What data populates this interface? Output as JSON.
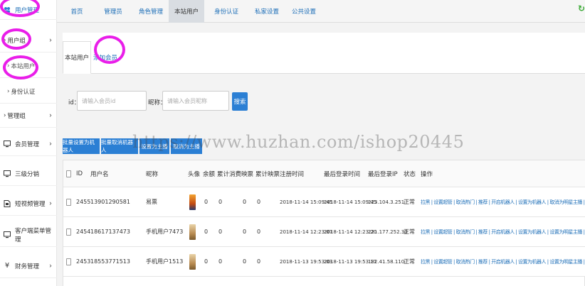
{
  "sidebar": {
    "items": [
      {
        "label": "用户管理",
        "icon": "users-icon"
      },
      {
        "label": "用户组",
        "icon": "group-icon"
      },
      {
        "label": "本站用户",
        "icon": "none"
      },
      {
        "label": "身份认证",
        "icon": "none"
      },
      {
        "label": "管理组",
        "icon": "none"
      },
      {
        "label": "会员管理",
        "icon": "monitor-icon"
      },
      {
        "label": "三级分销",
        "icon": "monitor-icon"
      },
      {
        "label": "短视频管理",
        "icon": "file-icon"
      },
      {
        "label": "客户端菜单管理",
        "icon": "monitor-icon"
      },
      {
        "label": "财务管理",
        "icon": "yen-icon"
      }
    ]
  },
  "topnav": {
    "items": [
      "首页",
      "管理员",
      "角色管理",
      "本站用户",
      "身份认证",
      "私家设置",
      "公共设置"
    ],
    "active": "本站用户"
  },
  "subtabs": {
    "items": [
      "本站用户",
      "添加会员"
    ],
    "active": "本站用户"
  },
  "search": {
    "id_label": "id：",
    "id_placeholder": "请输入会员id",
    "nick_label": "昵称：",
    "nick_placeholder": "请输入会员昵称",
    "button": "搜索"
  },
  "bulk_actions": [
    "批量设置为机器人",
    "批量取消机器人",
    "设置为主播",
    "取消为主播"
  ],
  "table": {
    "columns": [
      "ID",
      "用户名",
      "昵称",
      "头像",
      "余额",
      "累计消费",
      "映票",
      "累计映票",
      "注册时间",
      "最后登录时间",
      "最后登录IP",
      "状态",
      "操作"
    ],
    "rows": [
      {
        "id": "2455",
        "username": "13901290581",
        "nickname": "易票",
        "balance": "0",
        "total_spent": "0",
        "tickets": "0",
        "total_tickets": "0",
        "registered": "2018-11-14 15:09:45",
        "last_login": "2018-11-14 15:09:45",
        "last_ip": "223.104.3.251",
        "status": "正常",
        "actions": "拉黑 | 设置超管 | 取消热门 | 推荐 | 开启机器人 | 设置为机器人 | 取消为明星主播 | 编辑 | 删除"
      },
      {
        "id": "2454",
        "username": "18617137473",
        "nickname": "手机用户7473",
        "balance": "0",
        "total_spent": "0",
        "tickets": "0",
        "total_tickets": "0",
        "registered": "2018-11-14 12:23:07",
        "last_login": "2018-11-14 12:23:20",
        "last_ip": "221.177.252.30",
        "status": "正常",
        "actions": "拉黑 | 设置超管 | 取消热门 | 推荐 | 开启机器人 | 设置为机器人 | 设置为明星主播 | 编辑 | 删除"
      },
      {
        "id": "2453",
        "username": "18553771513",
        "nickname": "手机用户1513",
        "balance": "0",
        "total_spent": "0",
        "tickets": "0",
        "total_tickets": "0",
        "registered": "2018-11-13 19:53:03",
        "last_login": "2018-11-13 19:53:11",
        "last_ip": "182.41.58.110",
        "status": "正常",
        "actions": "拉黑 | 设置超管 | 取消热门 | 推荐 | 开启机器人 | 设置为机器人 | 设置为明星主播 | 编辑 | 删除"
      }
    ]
  },
  "watermark": "https://www.huzhan.com/ishop20445",
  "colors": {
    "link": "#1e6fb8",
    "button": "#2b7fd4",
    "highlight": "#e91ee9"
  }
}
